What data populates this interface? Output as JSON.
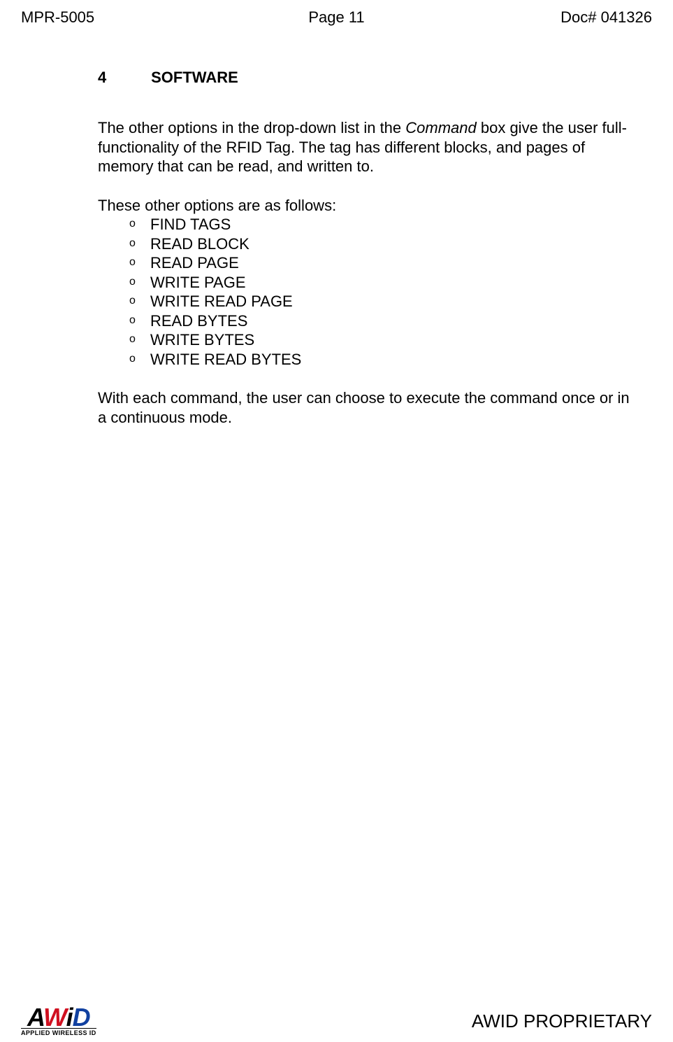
{
  "header": {
    "left": "MPR-5005",
    "center": "Page 11",
    "right": "Doc# 041326"
  },
  "section": {
    "number": "4",
    "title": "SOFTWARE"
  },
  "para1_pre": "The other options in the drop-down list in the ",
  "para1_italic": "Command",
  "para1_post": " box give the user full-functionality of the RFID Tag.  The tag has different blocks, and pages of memory that can be read, and written to.",
  "list_intro": "These other options are as follows:",
  "options": [
    "FIND TAGS",
    "READ BLOCK",
    "READ PAGE",
    "WRITE PAGE",
    "WRITE READ PAGE",
    "READ BYTES",
    "WRITE BYTES",
    "WRITE READ BYTES"
  ],
  "para2": "With each command, the user can choose to execute the command once or in a continuous mode.",
  "footer": {
    "logo_main": "AWiD",
    "logo_sub": "APPLIED WIRELESS ID",
    "proprietary": "AWID PROPRIETARY"
  }
}
